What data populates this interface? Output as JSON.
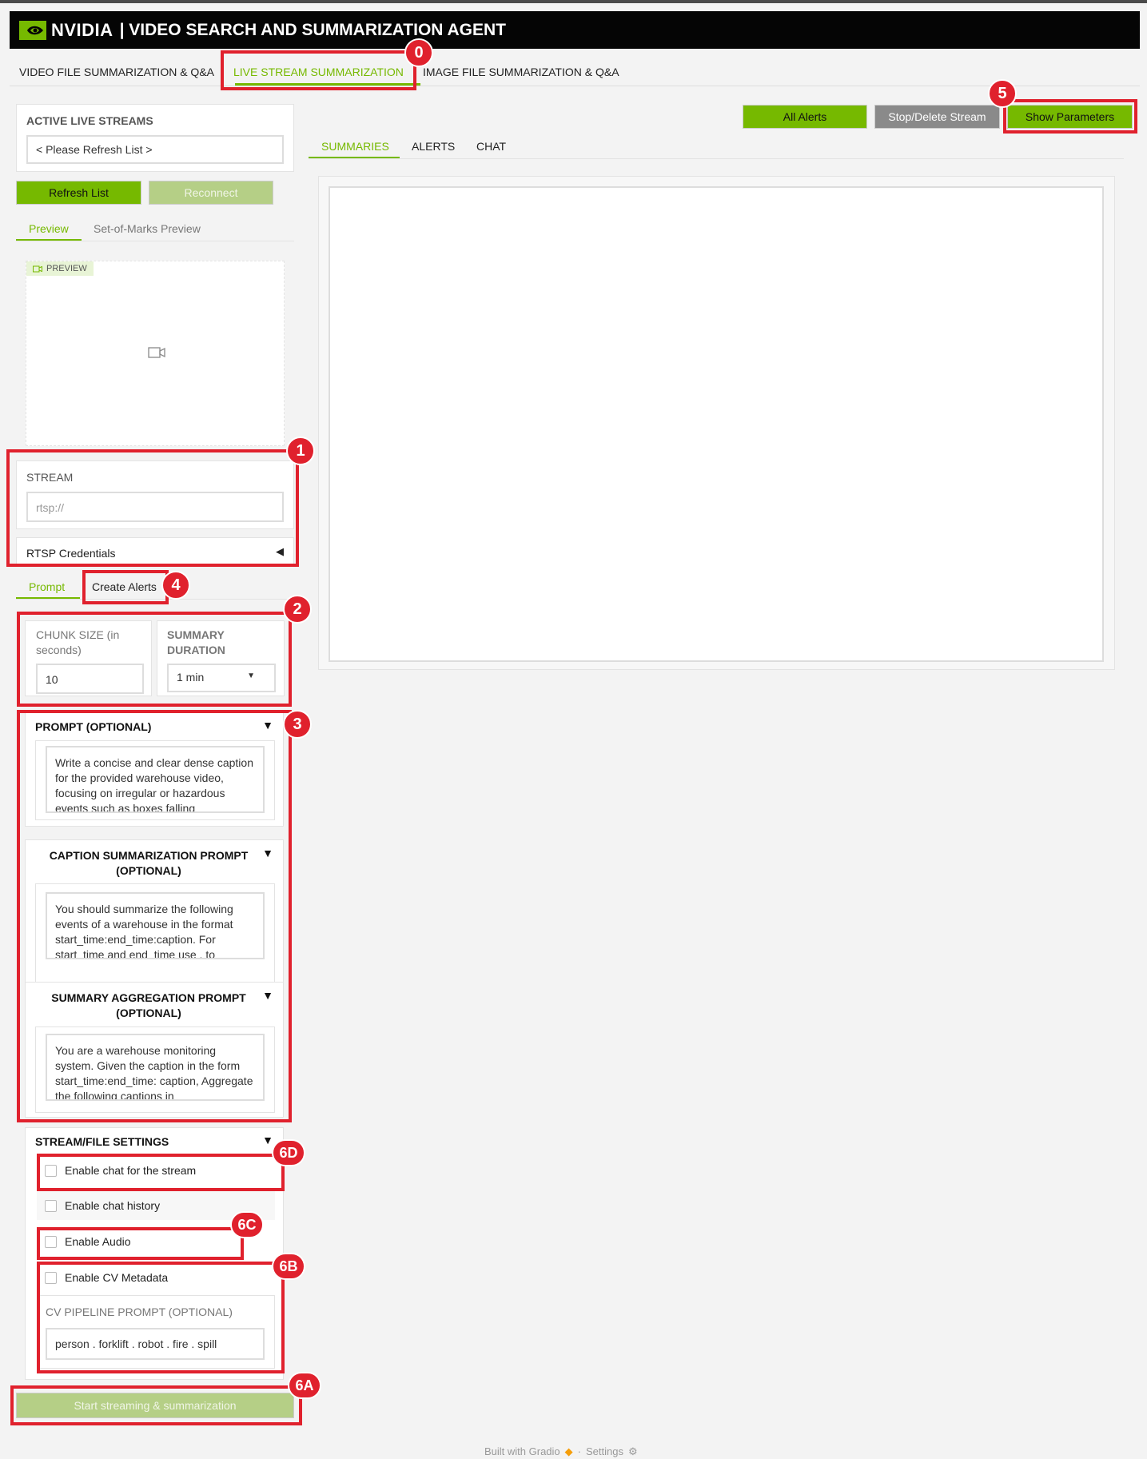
{
  "header": {
    "brand": "NVIDIA",
    "title": "| VIDEO SEARCH AND SUMMARIZATION AGENT"
  },
  "tabs": [
    {
      "label": "VIDEO FILE SUMMARIZATION & Q&A"
    },
    {
      "label": "LIVE STREAM SUMMARIZATION"
    },
    {
      "label": "IMAGE FILE SUMMARIZATION & Q&A"
    }
  ],
  "badges": {
    "b0": "0",
    "b1": "1",
    "b2": "2",
    "b3": "3",
    "b4": "4",
    "b5": "5",
    "b6a": "6A",
    "b6b": "6B",
    "b6c": "6C",
    "b6d": "6D"
  },
  "left": {
    "active_streams_label": "ACTIVE LIVE STREAMS",
    "streams_dropdown": "< Please Refresh List >",
    "refresh_button": "Refresh List",
    "reconnect_button": "Reconnect",
    "preview_tabs": [
      "Preview",
      "Set-of-Marks Preview"
    ],
    "preview_tag": "PREVIEW",
    "stream_label": "STREAM",
    "stream_placeholder": "rtsp://",
    "rtsp_credentials": "RTSP Credentials",
    "config_tabs": [
      "Prompt",
      "Create Alerts"
    ],
    "chunk_size_label": "CHUNK SIZE (in seconds)",
    "chunk_size_value": "10",
    "summary_duration_label": "SUMMARY DURATION",
    "summary_duration_value": "1 min",
    "prompt_label": "PROMPT (OPTIONAL)",
    "prompt_text": "Write a concise and clear dense caption for the provided warehouse video, focusing on irregular or hazardous events such as boxes falling",
    "caption_label": "CAPTION SUMMARIZATION PROMPT (OPTIONAL)",
    "caption_text": "You should summarize the following events of a warehouse in the format start_time:end_time:caption. For start_time and end_time use . to",
    "aggregation_label": "SUMMARY AGGREGATION PROMPT (OPTIONAL)",
    "aggregation_text": "You are a warehouse monitoring system. Given the caption in the form start_time:end_time: caption, Aggregate the following captions in",
    "settings_label": "STREAM/FILE SETTINGS",
    "enable_chat": "Enable chat for the stream",
    "enable_chat_history": "Enable chat history",
    "enable_audio": "Enable Audio",
    "enable_cv": "Enable CV Metadata",
    "cv_prompt_label": "CV PIPELINE PROMPT (OPTIONAL)",
    "cv_prompt_value": "person . forklift . robot . fire . spill",
    "start_button": "Start streaming & summarization"
  },
  "right": {
    "all_alerts": "All Alerts",
    "stop_delete": "Stop/Delete Stream",
    "show_parameters": "Show Parameters",
    "tabs": [
      "SUMMARIES",
      "ALERTS",
      "CHAT"
    ]
  },
  "footer": {
    "built_with": "Built with Gradio",
    "settings": "Settings"
  },
  "colors": {
    "accent": "#76b900",
    "annotation": "#e0212d"
  }
}
